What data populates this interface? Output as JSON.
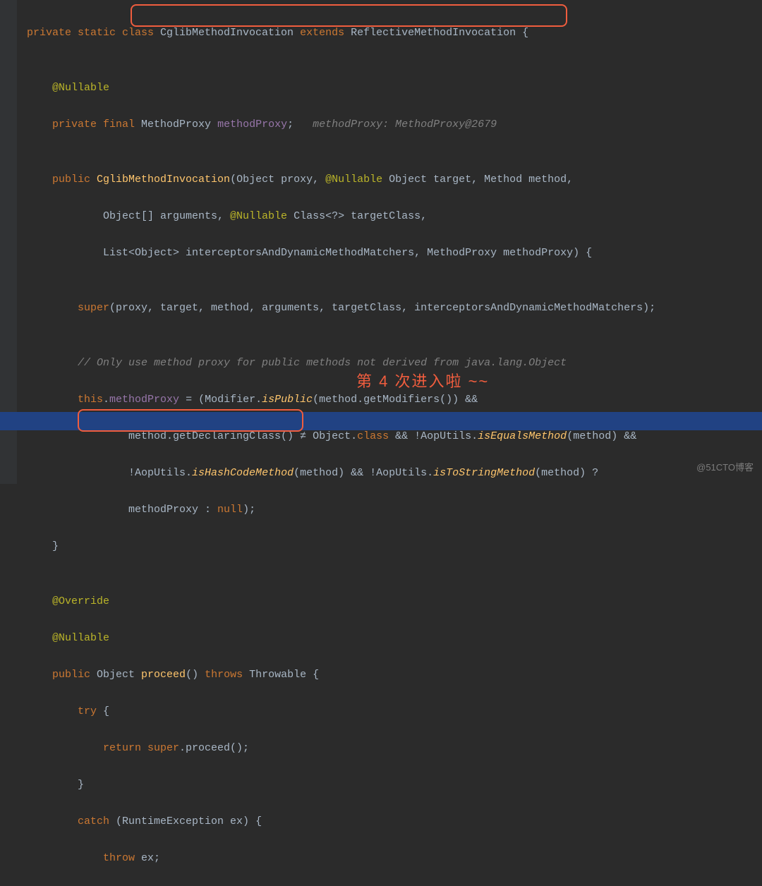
{
  "code": {
    "l1_a": "private static class ",
    "l1_b": "CglibMethodInvocation ",
    "l1_c": "extends ",
    "l1_d": "ReflectiveMethodInvocation {",
    "l2": "",
    "l3_a": "    @Nullable",
    "l4_a": "    private final ",
    "l4_b": "MethodProxy ",
    "l4_c": "methodProxy",
    "l4_d": ";   ",
    "l4_e": "methodProxy: MethodProxy@2679",
    "l5": "",
    "l6_a": "    public ",
    "l6_b": "CglibMethodInvocation",
    "l6_c": "(Object proxy, ",
    "l6_d": "@Nullable ",
    "l6_e": "Object target, Method method,",
    "l7_a": "            Object[] arguments, ",
    "l7_b": "@Nullable ",
    "l7_c": "Class<?> targetClass,",
    "l8_a": "            List<Object> interceptorsAndDynamicMethodMatchers, MethodProxy methodProxy) {",
    "l9": "",
    "l10_a": "        super",
    "l10_b": "(proxy, target, method, arguments, targetClass, interceptorsAndDynamicMethodMatchers);",
    "l11": "",
    "l12_a": "        // Only use method proxy for public methods not derived from java.lang.Object",
    "l13_a": "        this",
    "l13_b": ".",
    "l13_c": "methodProxy ",
    "l13_d": "= (Modifier.",
    "l13_e": "isPublic",
    "l13_f": "(method.getModifiers()) &&",
    "l14_a": "                method.getDeclaringClass() ",
    "l14_ne": "≠",
    "l14_b": " Object.",
    "l14_c": "class ",
    "l14_d": "&& !AopUtils.",
    "l14_e": "isEqualsMethod",
    "l14_f": "(method) &&",
    "l15_a": "                !AopUtils.",
    "l15_b": "isHashCodeMethod",
    "l15_c": "(method) && !AopUtils.",
    "l15_d": "isToStringMethod",
    "l15_e": "(method) ?",
    "l16_a": "                methodProxy : ",
    "l16_b": "null",
    "l16_c": ");",
    "l17_a": "    }",
    "l18": "",
    "l19_a": "    @Override",
    "l20_a": "    @Nullable",
    "l21_a": "    public ",
    "l21_b": "Object ",
    "l21_c": "proceed",
    "l21_d": "() ",
    "l21_e": "throws ",
    "l21_f": "Throwable {",
    "l22_a": "        try ",
    "l22_b": "{",
    "l23_a": "            return super",
    "l23_b": ".proceed();",
    "l24_a": "        }",
    "l25_a": "        catch ",
    "l25_b": "(RuntimeException ex) {",
    "l26_a": "            throw ",
    "l26_b": "ex;"
  },
  "annotation": "第 4 次进入啦 ~~",
  "watermark": "@51CTO博客"
}
